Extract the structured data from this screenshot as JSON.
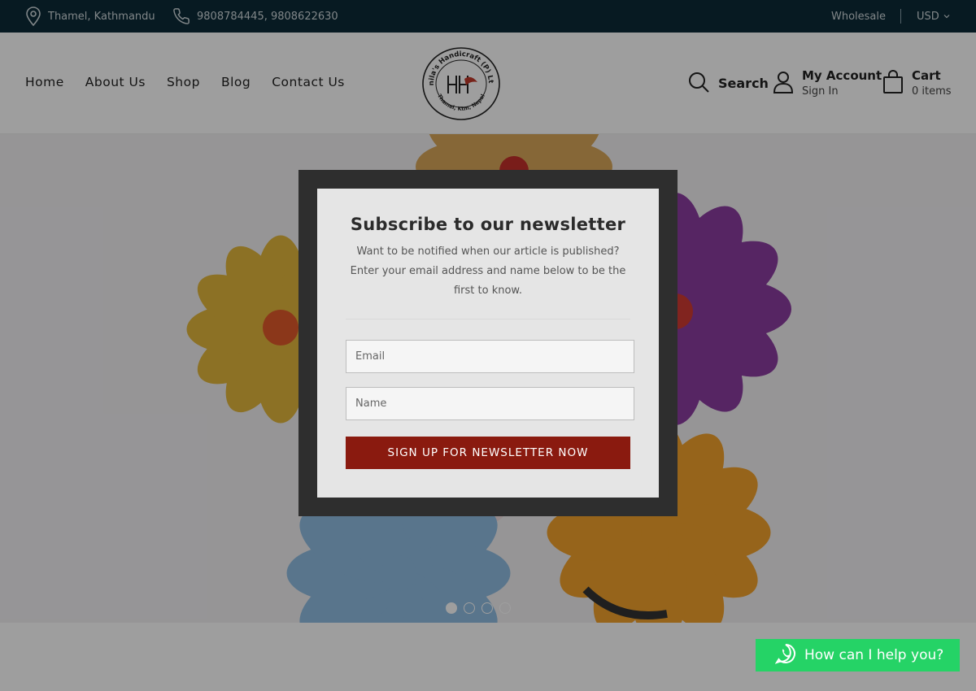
{
  "topbar": {
    "location": "Thamel, Kathmandu",
    "phone": "9808784445, 9808622630",
    "wholesale": "Wholesale",
    "currency": "USD"
  },
  "nav": {
    "items": [
      "Home",
      "About Us",
      "Shop",
      "Blog",
      "Contact Us"
    ]
  },
  "logo": {
    "text_top": "Anila's Handicraft (P) Ltd.",
    "text_bottom": "Thamel, Ktm, Nepal"
  },
  "header_actions": {
    "search_label": "Search",
    "account_title": "My Account",
    "account_sub": "Sign In",
    "cart_title": "Cart",
    "cart_sub": "0 items"
  },
  "slider": {
    "dot_count": 4,
    "active_index": 0
  },
  "newsletter": {
    "title": "Subscribe to our newsletter",
    "description": "Want to be notified when our article is published? Enter your email address and name below to be the first to know.",
    "email_placeholder": "Email",
    "name_placeholder": "Name",
    "button_label": "SIGN UP FOR NEWSLETTER NOW"
  },
  "whatsapp": {
    "label": "How can I help you?"
  },
  "colors": {
    "topbar_bg": "#0c2a37",
    "button_bg": "#8a1a0f",
    "whatsapp_bg": "#25d366"
  }
}
